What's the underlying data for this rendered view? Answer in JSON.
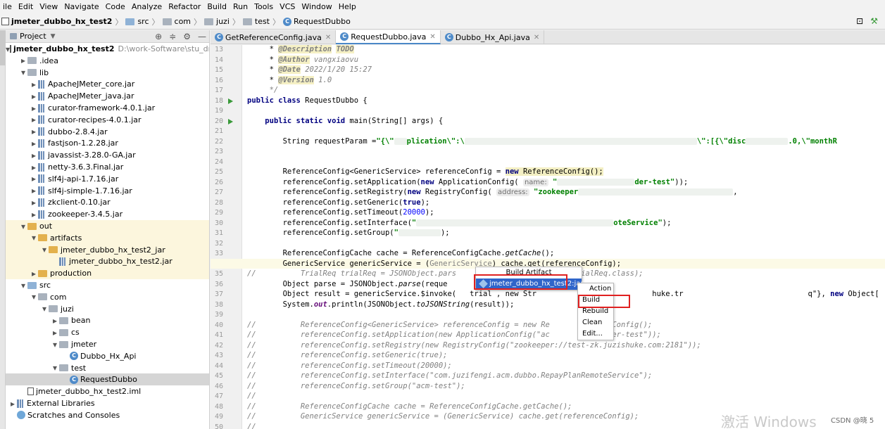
{
  "menu": [
    "ile",
    "Edit",
    "View",
    "Navigate",
    "Code",
    "Analyze",
    "Refactor",
    "Build",
    "Run",
    "Tools",
    "VCS",
    "Window",
    "Help"
  ],
  "breadcrumb": {
    "project": "jmeter_dubbo_hx_test2",
    "parts": [
      "src",
      "com",
      "juzi",
      "test"
    ],
    "file": "RequestDubbo"
  },
  "project_panel": {
    "title": "Project",
    "tree": [
      {
        "indent": 0,
        "arrow": "v",
        "icon": "module",
        "label": "jmeter_dubbo_hx_test2",
        "extra": "D:\\work-Software\\stu_draggab",
        "bold": true
      },
      {
        "indent": 1,
        "arrow": ">",
        "icon": "folder",
        "label": ".idea"
      },
      {
        "indent": 1,
        "arrow": "v",
        "icon": "folder",
        "label": "lib"
      },
      {
        "indent": 2,
        "arrow": ">",
        "icon": "jar",
        "label": "ApacheJMeter_core.jar"
      },
      {
        "indent": 2,
        "arrow": ">",
        "icon": "jar",
        "label": "ApacheJMeter_java.jar"
      },
      {
        "indent": 2,
        "arrow": ">",
        "icon": "jar",
        "label": "curator-framework-4.0.1.jar"
      },
      {
        "indent": 2,
        "arrow": ">",
        "icon": "jar",
        "label": "curator-recipes-4.0.1.jar"
      },
      {
        "indent": 2,
        "arrow": ">",
        "icon": "jar",
        "label": "dubbo-2.8.4.jar"
      },
      {
        "indent": 2,
        "arrow": ">",
        "icon": "jar",
        "label": "fastjson-1.2.28.jar"
      },
      {
        "indent": 2,
        "arrow": ">",
        "icon": "jar",
        "label": "javassist-3.28.0-GA.jar"
      },
      {
        "indent": 2,
        "arrow": ">",
        "icon": "jar",
        "label": "netty-3.6.3.Final.jar"
      },
      {
        "indent": 2,
        "arrow": ">",
        "icon": "jar",
        "label": "slf4j-api-1.7.16.jar"
      },
      {
        "indent": 2,
        "arrow": ">",
        "icon": "jar",
        "label": "slf4j-simple-1.7.16.jar"
      },
      {
        "indent": 2,
        "arrow": ">",
        "icon": "jar",
        "label": "zkclient-0.10.jar"
      },
      {
        "indent": 2,
        "arrow": ">",
        "icon": "jar",
        "label": "zookeeper-3.4.5.jar"
      },
      {
        "indent": 1,
        "arrow": "v",
        "icon": "folder-yellow",
        "label": "out",
        "hl": true
      },
      {
        "indent": 2,
        "arrow": "v",
        "icon": "folder-yellow",
        "label": "artifacts",
        "hl": true
      },
      {
        "indent": 3,
        "arrow": "v",
        "icon": "folder-yellow",
        "label": "jmeter_dubbo_hx_test2_jar",
        "hl": true
      },
      {
        "indent": 4,
        "arrow": "",
        "icon": "jar",
        "label": "jmeter_dubbo_hx_test2.jar",
        "hl": true
      },
      {
        "indent": 2,
        "arrow": ">",
        "icon": "folder-yellow",
        "label": "production",
        "hl": true
      },
      {
        "indent": 1,
        "arrow": "v",
        "icon": "folder-blue",
        "label": "src"
      },
      {
        "indent": 2,
        "arrow": "v",
        "icon": "folder",
        "label": "com"
      },
      {
        "indent": 3,
        "arrow": "v",
        "icon": "folder",
        "label": "juzi"
      },
      {
        "indent": 4,
        "arrow": ">",
        "icon": "folder",
        "label": "bean"
      },
      {
        "indent": 4,
        "arrow": ">",
        "icon": "folder",
        "label": "cs"
      },
      {
        "indent": 4,
        "arrow": "v",
        "icon": "folder",
        "label": "jmeter"
      },
      {
        "indent": 5,
        "arrow": "",
        "icon": "class",
        "label": "Dubbo_Hx_Api"
      },
      {
        "indent": 4,
        "arrow": "v",
        "icon": "folder",
        "label": "test"
      },
      {
        "indent": 5,
        "arrow": "",
        "icon": "class",
        "label": "RequestDubbo",
        "sel": true
      },
      {
        "indent": 1,
        "arrow": "",
        "icon": "iml",
        "label": "jmeter_dubbo_hx_test2.iml"
      },
      {
        "indent": 0,
        "arrow": ">",
        "icon": "lib",
        "label": "External Libraries"
      },
      {
        "indent": 0,
        "arrow": "",
        "icon": "scratch",
        "label": "Scratches and Consoles"
      }
    ]
  },
  "tabs": [
    {
      "label": "GetReferenceConfig.java",
      "active": false
    },
    {
      "label": "RequestDubbo.java",
      "active": true
    },
    {
      "label": "Dubbo_Hx_Api.java",
      "active": false
    }
  ],
  "code_lines": [
    {
      "n": "13",
      "html": "     * <span class='tag'>@Description</span> <span class='tag'>TODO</span>"
    },
    {
      "n": "14",
      "html": "     * <span class='tag'>@Author</span> <span class='val'>vangxiaovu</span>"
    },
    {
      "n": "15",
      "html": "     * <span class='tag'>@Date</span> <span class='val'>2022/1/20 15:27</span>"
    },
    {
      "n": "16",
      "html": "     * <span class='tag'>@Version</span> <span class='val'>1.0</span>"
    },
    {
      "n": "17",
      "html": "     <span class='cm'>*/</span>"
    },
    {
      "n": "18",
      "html": "<span class='kw'>public class</span> RequestDubbo {",
      "run": true
    },
    {
      "n": "19",
      "html": ""
    },
    {
      "n": "20",
      "html": "    <span class='kw'>public static void</span> main(String[] args) {",
      "run": true
    },
    {
      "n": "21",
      "html": ""
    },
    {
      "n": "22",
      "html": "        String requestParam =<span class='str'>\"{\\\"</span><span class='blur' style='width:18px'></span><span class='str'>plication\\\":\\</span><span class='blur' style='width:330px'></span><span class='str'>\\\":[{\\\"disc</span><span class='blur' style='width:60px'></span><span class='str'>.0,\\\"monthR</span>"
    },
    {
      "n": "23",
      "html": ""
    },
    {
      "n": "24",
      "html": ""
    },
    {
      "n": "25",
      "html": "        ReferenceConfig&lt;GenericService&gt; referenceConfig = <span class='kw hl2'>new</span><span class='hl2'> ReferenceConfig();</span>"
    },
    {
      "n": "26",
      "html": "        referenceConfig.setApplication(<span class='kw'>new</span> ApplicationConfig( <span class='hint'>name:</span> <span class='str'>\"</span><span class='blur' style='width:110px'></span><span class='str'>der-test\"</span>));"
    },
    {
      "n": "27",
      "html": "        referenceConfig.setRegistry(<span class='kw'>new</span> RegistryConfig( <span class='hint'>address:</span> <span class='str'>\"zookeeper</span><span class='blur' style='width:220px'></span>,"
    },
    {
      "n": "28",
      "html": "        referenceConfig.setGeneric(<span class='kw'>true</span>);"
    },
    {
      "n": "29",
      "html": "        referenceConfig.setTimeout(<span style='color:#0000ff'>20000</span>);"
    },
    {
      "n": "30",
      "html": "        referenceConfig.setInterface(<span class='str'>\"</span><span class='blur' style='width:280px'></span><span class='str'>oteService\"</span>);"
    },
    {
      "n": "31",
      "html": "        referenceConfig.setGroup(<span class='str'>\"</span><span class='blur' style='width:60px'></span>);"
    },
    {
      "n": "32",
      "html": ""
    },
    {
      "n": "33",
      "html": "        ReferenceConfigCache cache = ReferenceConfigCache.<span class='it'>getCache</span>();"
    },
    {
      "n": "34",
      "html": "        GenericService genericService = (<span style='color:#808080'>GenericService</span>) cache.get(referenceConfig);",
      "cur": true
    },
    {
      "n": "35",
      "html": "<span class='cm'>//          TrialReq trialReq = JSONObject.pars                          TrialReq.class);</span>"
    },
    {
      "n": "36",
      "html": "        Object parse = JSONObject.<span class='it'>parse</span>(reque"
    },
    {
      "n": "37",
      "html": "        Object result = genericService.$invoke(   trial , new Str          ion             huke.tr                            q\"}, <span class='kw'>new</span> Object[ </span>"
    },
    {
      "n": "38",
      "html": "        System.<span class='it' style='color:#660e7a;font-weight:bold'>out</span>.println(JSONObject.<span class='it'>toJSONString</span>(result));"
    },
    {
      "n": "39",
      "html": ""
    },
    {
      "n": "40",
      "html": "<span class='cm'>//          ReferenceConfig&lt;GenericService&gt; referenceConfig = new Re              Config();</span>"
    },
    {
      "n": "41",
      "html": "<span class='cm'>//          referenceConfig.setApplication(new ApplicationConfig(\"ac             der-test\"));</span>"
    },
    {
      "n": "42",
      "html": "<span class='cm'>//          referenceConfig.setRegistry(new RegistryConfig(\"zookeeper://test-zk.juzishuke.com:2181\"));</span>"
    },
    {
      "n": "43",
      "html": "<span class='cm'>//          referenceConfig.setGeneric(true);</span>"
    },
    {
      "n": "44",
      "html": "<span class='cm'>//          referenceConfig.setTimeout(20000);</span>"
    },
    {
      "n": "45",
      "html": "<span class='cm'>//          referenceConfig.setInterface(\"com.juzifengi.acm.dubbo.RepayPlanRemoteService\");</span>"
    },
    {
      "n": "46",
      "html": "<span class='cm'>//          referenceConfig.setGroup(\"acm-test\");</span>"
    },
    {
      "n": "47",
      "html": "<span class='cm'>//</span>"
    },
    {
      "n": "48",
      "html": "<span class='cm'>//          ReferenceConfigCache cache = ReferenceConfigCache.getCache();</span>"
    },
    {
      "n": "49",
      "html": "<span class='cm'>//          GenericService genericService = (GenericService) cache.get(referenceConfig);</span>"
    },
    {
      "n": "50",
      "html": "<span class='cm'>//</span>"
    }
  ],
  "build_artifact_menu": {
    "title": "Build Artifact",
    "item": "jmeter_dubbo_hx_test2:jar"
  },
  "action_menu": {
    "title": "Action",
    "items": [
      "Build",
      "Rebuild",
      "Clean",
      "Edit..."
    ]
  },
  "watermark": "激活 Windows",
  "credit": "CSDN @晓 5"
}
